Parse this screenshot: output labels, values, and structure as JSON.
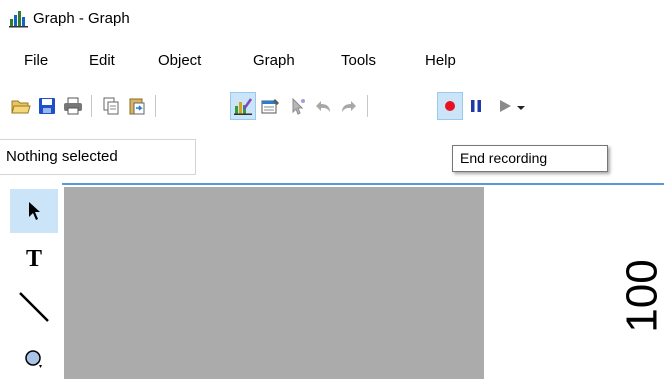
{
  "window": {
    "title": "Graph - Graph"
  },
  "menu": {
    "items": [
      "File",
      "Edit",
      "Object",
      "Graph",
      "Tools",
      "Help"
    ]
  },
  "toolbar": {
    "icons": [
      "open-icon",
      "save-icon",
      "print-icon",
      "copy-icon",
      "paste-icon",
      "chart-icon",
      "properties-icon",
      "pointer-icon",
      "undo-icon",
      "redo-icon",
      "record-icon",
      "pause-icon",
      "play-icon"
    ],
    "active": "record-icon"
  },
  "status": {
    "text": "Nothing selected"
  },
  "tooltip": {
    "text": "End recording"
  },
  "tools": {
    "items": [
      "select-arrow-icon",
      "text-tool-icon",
      "line-tool-icon",
      "ellipse-tool-icon"
    ],
    "active": "select-arrow-icon",
    "text_tool_glyph": "T"
  },
  "canvas": {
    "axis_value": "100"
  },
  "colors": {
    "accent": "#5b9bd5",
    "selection": "#cce4f7",
    "record": "#e81123",
    "gray_area": "#ababab"
  }
}
